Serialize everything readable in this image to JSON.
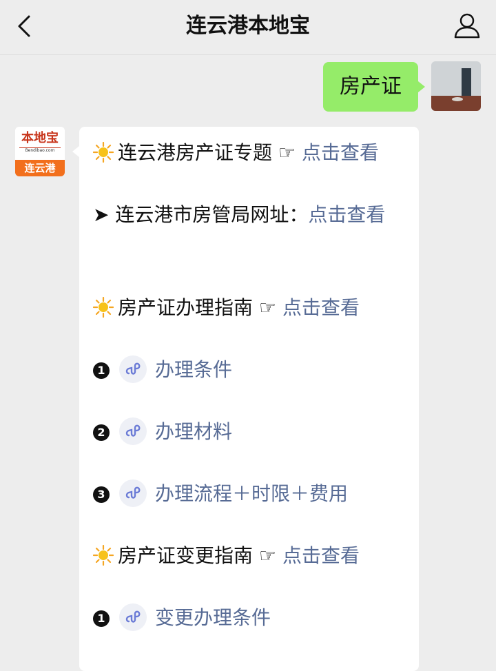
{
  "header": {
    "title": "连云港本地宝"
  },
  "user_message": {
    "text": "房产证"
  },
  "bot_avatar": {
    "brand_cn": "本地宝",
    "brand_en": "Bendibao.com",
    "city": "连云港"
  },
  "bot_message": {
    "lines": [
      {
        "icon": "sun-icon",
        "text": "连云港房产证专题",
        "pointer": "☞",
        "link": "点击查看"
      },
      {
        "icon": "arrow-icon",
        "prefix": "➤",
        "text": "连云港市房管局网址：",
        "link": "点击查看"
      },
      {
        "icon": "sun-icon",
        "text": "房产证办理指南",
        "pointer": "☞",
        "link": "点击查看"
      },
      {
        "num": "1",
        "link": "办理条件"
      },
      {
        "num": "2",
        "link": "办理材料"
      },
      {
        "num": "3",
        "link": "办理流程＋时限＋费用"
      },
      {
        "icon": "sun-icon",
        "text": "房产证变更指南",
        "pointer": "☞",
        "link": "点击查看"
      },
      {
        "num": "1",
        "link": "变更办理条件"
      }
    ]
  },
  "colors": {
    "link": "#576b95",
    "user_bubble": "#95ec69",
    "background": "#ededed"
  }
}
